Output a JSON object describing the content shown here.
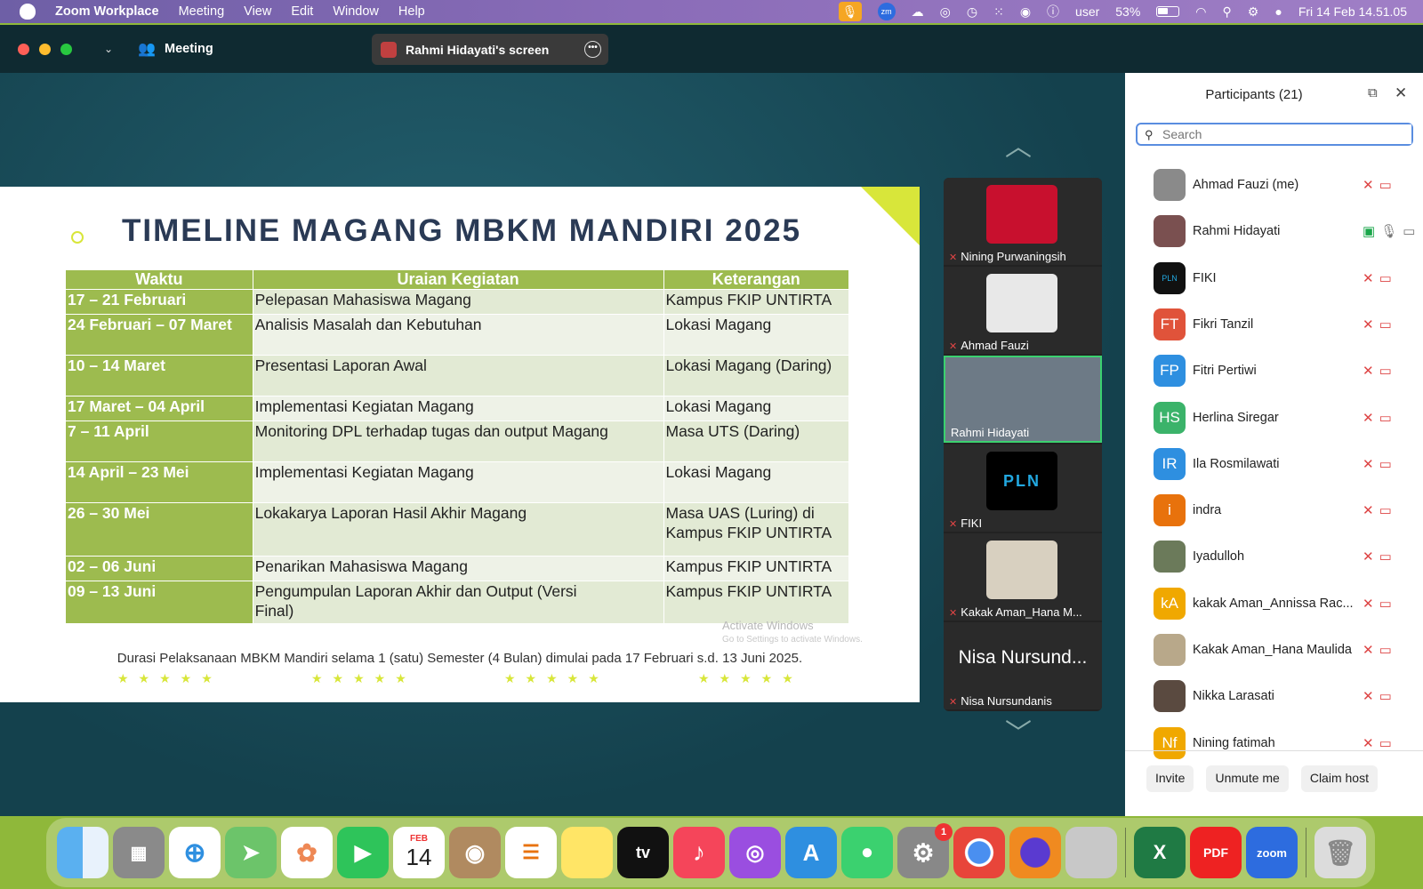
{
  "menubar": {
    "app": "Zoom Workplace",
    "items": [
      "Meeting",
      "View",
      "Edit",
      "Window",
      "Help"
    ],
    "user": "user",
    "battery": "53%",
    "datetime": "Fri 14 Feb  14.51.05"
  },
  "titlebar": {
    "meeting_label": "Meeting",
    "share_label": "Rahmi Hidayati's screen"
  },
  "slide": {
    "title": "TIMELINE MAGANG MBKM MANDIRI 2025",
    "headers": [
      "Waktu",
      "Uraian Kegiatan",
      "Keterangan"
    ],
    "rows": [
      [
        "17 – 21  Februari",
        "Pelepasan Mahasiswa Magang",
        "Kampus FKIP UNTIRTA"
      ],
      [
        "24 Februari – 07 Maret",
        "Analisis Masalah dan Kebutuhan",
        "Lokasi Magang"
      ],
      [
        "10 – 14 Maret",
        "Presentasi Laporan Awal",
        "Lokasi Magang (Daring)"
      ],
      [
        "17 Maret – 04 April",
        "Implementasi Kegiatan Magang",
        "Lokasi Magang"
      ],
      [
        "7 – 11 April",
        "Monitoring DPL terhadap tugas dan output Magang",
        "Masa UTS (Daring)"
      ],
      [
        "14 April – 23 Mei",
        "Implementasi Kegiatan Magang",
        "Lokasi Magang"
      ],
      [
        "26 – 30 Mei",
        "Lokakarya Laporan Hasil Akhir Magang",
        "Masa UAS (Luring) di Kampus FKIP UNTIRTA"
      ],
      [
        "02 – 06 Juni",
        "Penarikan Mahasiswa Magang",
        "Kampus FKIP UNTIRTA"
      ],
      [
        "09 – 13 Juni",
        "Pengumpulan Laporan Akhir dan Output (Versi Final)",
        "Kampus FKIP UNTIRTA"
      ]
    ],
    "note": "Durasi Pelaksanaan MBKM Mandiri selama 1 (satu) Semester (4 Bulan) dimulai pada 17 Februari s.d. 13 Juni 2025.",
    "watermark1": "Activate Windows",
    "watermark2": "Go to Settings to activate Windows."
  },
  "gallery": {
    "tiles": [
      {
        "name": "Nining Purwaningsih"
      },
      {
        "name": "Ahmad Fauzi"
      },
      {
        "name": "Rahmi Hidayati"
      },
      {
        "name": "FIKI"
      },
      {
        "name": "Kakak Aman_Hana M..."
      },
      {
        "name": "Nisa Nursundanis",
        "big": "Nisa Nursund..."
      }
    ]
  },
  "participants": {
    "title": "Participants (21)",
    "search_placeholder": "Search",
    "list": [
      {
        "name": "Ahmad Fauzi (me)",
        "initials": "",
        "color": "#8a8a8a"
      },
      {
        "name": "Rahmi Hidayati",
        "initials": "",
        "color": "#7a5050"
      },
      {
        "name": "FIKI",
        "initials": "PLN",
        "color": "#111111"
      },
      {
        "name": "Fikri Tanzil",
        "initials": "FT",
        "color": "#e0533a"
      },
      {
        "name": "Fitri Pertiwi",
        "initials": "FP",
        "color": "#2e8fe0"
      },
      {
        "name": "Herlina Siregar",
        "initials": "HS",
        "color": "#3bb36a"
      },
      {
        "name": "Ila Rosmilawati",
        "initials": "IR",
        "color": "#2e8fe0"
      },
      {
        "name": "indra",
        "initials": "i",
        "color": "#e8720c"
      },
      {
        "name": "Iyadulloh",
        "initials": "",
        "color": "#6b7a5a"
      },
      {
        "name": "kakak Aman_Annissa Rac...",
        "initials": "kA",
        "color": "#f0a800"
      },
      {
        "name": "Kakak Aman_Hana Maulida",
        "initials": "",
        "color": "#b8a88a"
      },
      {
        "name": "Nikka Larasati",
        "initials": "",
        "color": "#5a4a40"
      },
      {
        "name": "Nining fatimah",
        "initials": "Nf",
        "color": "#f0a800"
      }
    ],
    "buttons": [
      "Invite",
      "Unmute me",
      "Claim host"
    ]
  },
  "dock": {
    "calendar_month": "FEB",
    "calendar_day": "14",
    "tv": "tv",
    "pdf": "PDF",
    "zoom": "zoom",
    "settings_badge": "1",
    "excel": "X"
  }
}
